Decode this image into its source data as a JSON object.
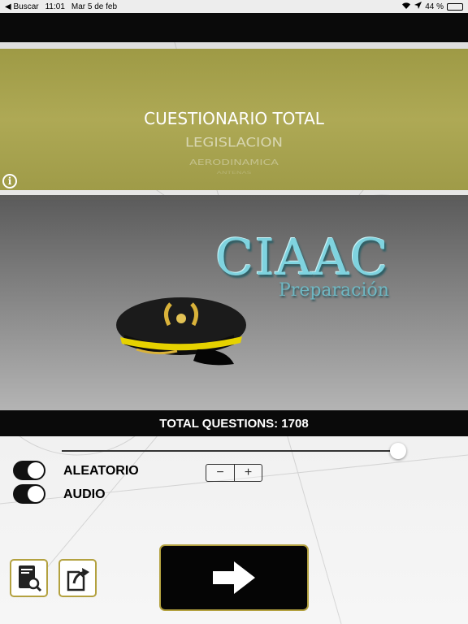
{
  "status_bar": {
    "back_label": "Buscar",
    "time": "11:01",
    "date": "Mar 5 de feb",
    "battery": "44 %",
    "battery_level": 0.44
  },
  "picker": {
    "items": [
      "CUESTIONARIO TOTAL",
      "LEGISLACION",
      "AERODINAMICA",
      "ANTENAS"
    ],
    "selected_index": 0,
    "background_color": "#a9a450"
  },
  "hero": {
    "logo_title": "CIAAC",
    "logo_subtitle": "Preparación"
  },
  "summary": {
    "total_questions_label": "TOTAL QUESTIONS: 1708"
  },
  "slider": {
    "value": 1.0
  },
  "options": [
    {
      "label": "ALEATORIO",
      "on": true
    },
    {
      "label": "AUDIO",
      "on": true
    }
  ],
  "stepper": {
    "minus": "−",
    "plus": "+"
  },
  "colors": {
    "accent_border": "#b3a13f",
    "logo": "#7fd3df"
  },
  "icons": {
    "left_button": "book-search-icon",
    "middle_button": "export-icon",
    "main_button": "arrow-right-icon"
  }
}
